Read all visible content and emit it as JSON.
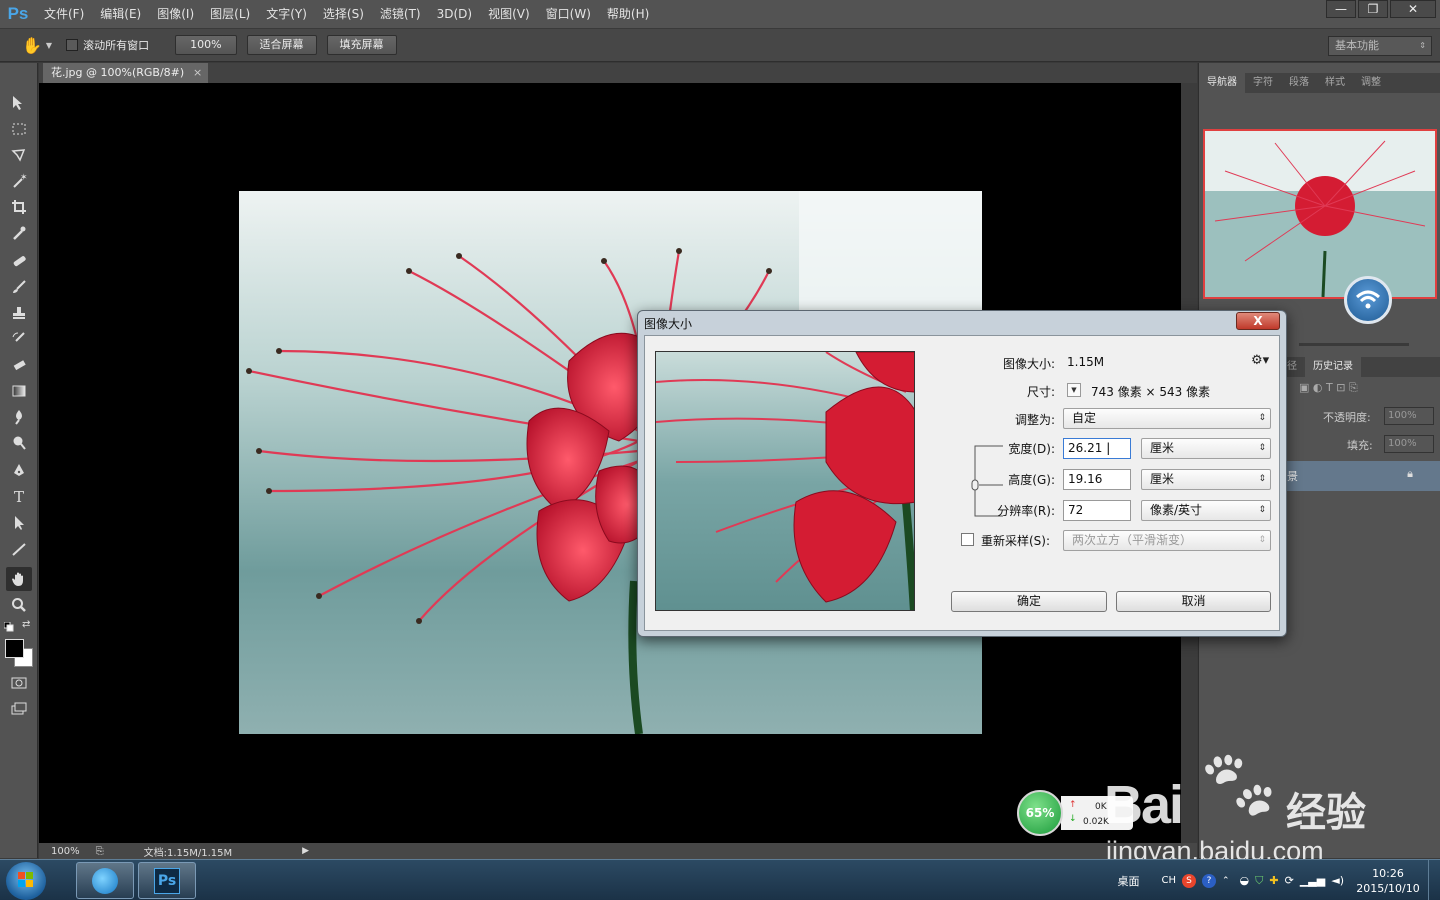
{
  "app": {
    "logo": "Ps",
    "menu": [
      "文件(F)",
      "编辑(E)",
      "图像(I)",
      "图层(L)",
      "文字(Y)",
      "选择(S)",
      "滤镜(T)",
      "3D(D)",
      "视图(V)",
      "窗口(W)",
      "帮助(H)"
    ],
    "window_controls": [
      "—",
      "❐",
      "✕"
    ]
  },
  "options": {
    "scroll_all_windows": "滚动所有窗口",
    "btn_100": "100%",
    "btn_fit": "适合屏幕",
    "btn_fill": "填充屏幕",
    "workspace": "基本功能"
  },
  "document": {
    "tab_title": "花.jpg @ 100%(RGB/8#)",
    "tab_close": "×",
    "zoom": "100%",
    "doc_size": "文档:1.15M/1.15M"
  },
  "panels": {
    "top_tabs": [
      "导航器",
      "字符",
      "段落",
      "样式",
      "调整"
    ],
    "mid_tabs": [
      "径",
      "历史记录"
    ],
    "opacity_label": "不透明度:",
    "opacity_value": "100%",
    "fill_label": "填充:",
    "fill_value": "100%",
    "layer_name": "景"
  },
  "dialog": {
    "title": "图像大小",
    "close": "X",
    "image_size_label": "图像大小:",
    "image_size_value": "1.15M",
    "dimensions_label": "尺寸:",
    "dimensions_value": "743 像素 × 543 像素",
    "fit_to_label": "调整为:",
    "fit_to_value": "自定",
    "width_label": "宽度(D):",
    "width_value": "26.21",
    "width_unit": "厘米",
    "height_label": "高度(G):",
    "height_value": "19.16",
    "height_unit": "厘米",
    "resolution_label": "分辨率(R):",
    "resolution_value": "72",
    "resolution_unit": "像素/英寸",
    "resample_label": "重新采样(S):",
    "resample_value": "两次立方（平滑渐变）",
    "ok": "确定",
    "cancel": "取消"
  },
  "net_widget": {
    "percent": "65%",
    "up": "0K",
    "down": "0.02K"
  },
  "watermark": {
    "brand": "Bai",
    "brand2": "经验",
    "url": "jingyan.baidu.com"
  },
  "taskbar": {
    "desktop_label": "桌面",
    "lang": "CH",
    "time": "10:26",
    "date": "2015/10/10"
  },
  "colors": {
    "ps_blue": "#4aa6e8",
    "dialog_frame": "#c7d1da",
    "close_red": "#c0392b"
  }
}
